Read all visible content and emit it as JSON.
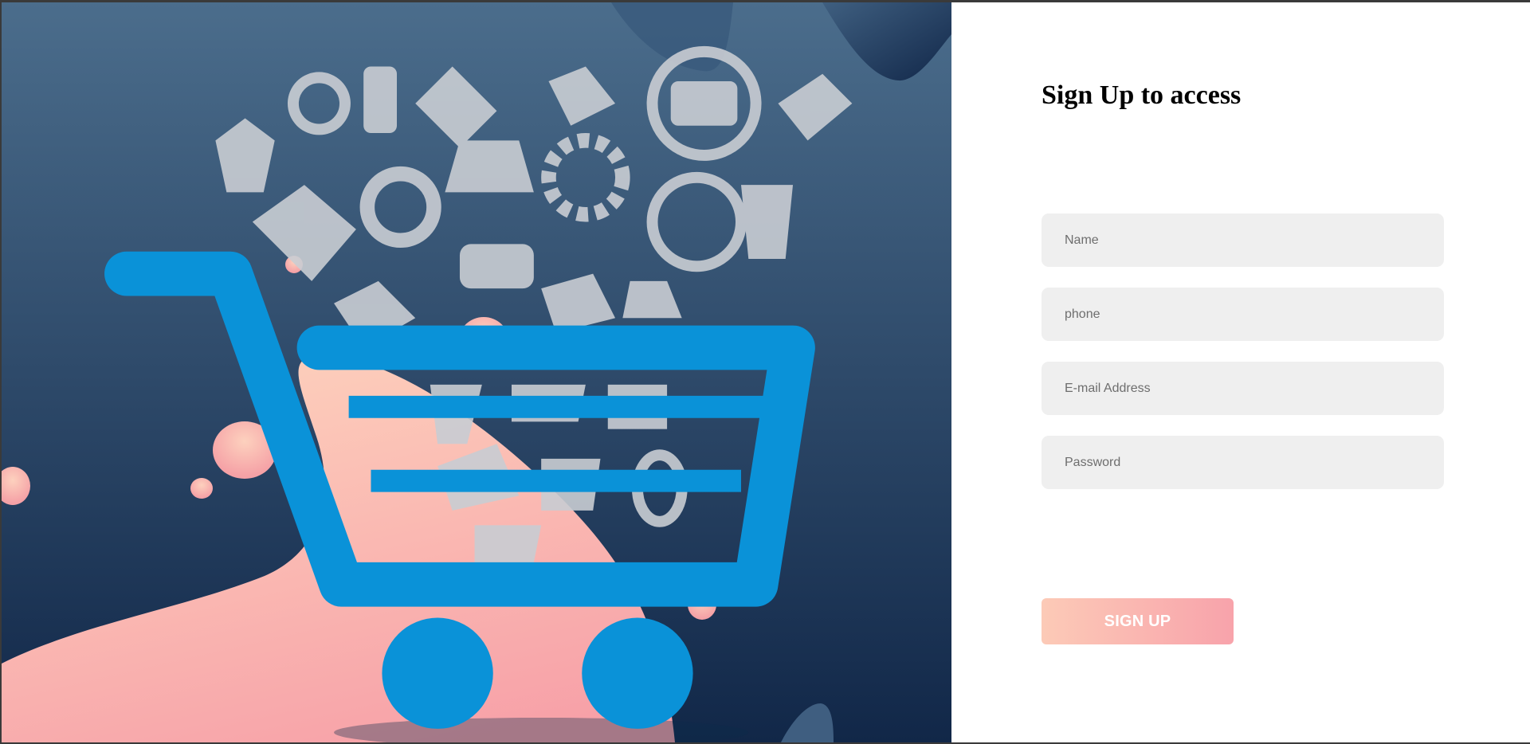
{
  "form": {
    "title": "Sign Up to access",
    "fields": {
      "name_placeholder": "Name",
      "phone_placeholder": "phone",
      "email_placeholder": "E-mail Address",
      "password_placeholder": "Password"
    },
    "submit_label": "SIGN UP"
  },
  "logo": {
    "icon": "shopping-cart-logo-icon"
  },
  "colors": {
    "hero_gradient_top": "#4b6d8c",
    "hero_gradient_bottom": "#112748",
    "blob_light": "#fdd0bc",
    "blob_dark": "#f7a1a8",
    "cart_blue": "#0a92d8",
    "field_bg": "#efefef",
    "button_gradient_start": "#fccab7",
    "button_gradient_end": "#f8a3ab"
  }
}
